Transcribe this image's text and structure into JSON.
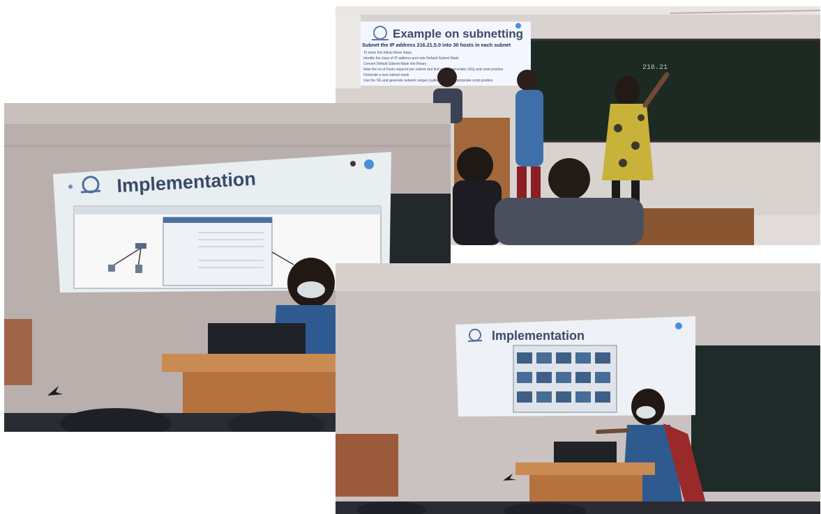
{
  "photos": {
    "top_right": {
      "slide_title": "Example on subnetting",
      "slide_subtitle": "Subnet the IP address 216.21.5.0 into 30 hosts in each subnet",
      "slide_lines": [
        "To solve this follow these steps:",
        "Identify the class of IP address and note Default Subnet Mask",
        "Convert Default Subnet Mask into Binary",
        "Note the no of hosts required per subnet and find subnet generator (SG) and octet position",
        "Generate a new subnet mask",
        "Use the SG and generate network ranges (subnets) in the appropriate octet position"
      ],
      "board_text": "216.21"
    },
    "left": {
      "slide_title": "Implementation"
    },
    "bottom_right": {
      "slide_title": "Implementation"
    }
  },
  "colors": {
    "wall": "#bfb8b6",
    "board": "#1d2a24",
    "podium": "#b5713e",
    "kurta": "#2f5a8f",
    "dupatta": "#9a2a2a"
  }
}
